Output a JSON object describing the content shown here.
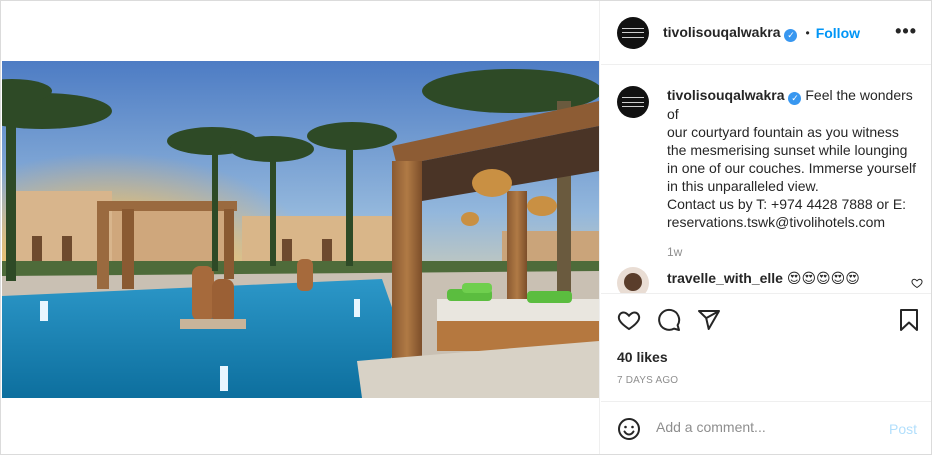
{
  "post": {
    "username": "tivolisouqalwakra",
    "follow_label": "Follow",
    "more_label": "•••",
    "separator": "•",
    "verified_glyph": "✓",
    "image_alt": "Courtyard fountain with palm trees and lounge couches at sunset"
  },
  "caption": {
    "username": "tivolisouqalwakra",
    "lines": [
      "Feel the wonders of",
      "our courtyard fountain as you witness",
      "the mesmerising sunset while lounging",
      "in one of our couches. Immerse yourself",
      "in this unparalleled view.",
      "Contact us by T: +974 4428 7888 or E:",
      "reservations.tswk@tivolihotels.com"
    ],
    "time": "1w"
  },
  "comment": {
    "username": "travelle_with_elle",
    "text": "😍😍😍😍😍"
  },
  "actions": {
    "icons": [
      "heart-icon",
      "comment-icon",
      "share-icon",
      "bookmark-icon"
    ]
  },
  "likes": "40 likes",
  "date": "7 DAYS AGO",
  "add_comment": {
    "placeholder": "Add a comment...",
    "post_label": "Post",
    "emoji_icon": "emoji-icon"
  },
  "colors": {
    "accent": "#0095f6",
    "verified": "#3897f0",
    "muted": "#8e8e8e",
    "post_disabled": "#b2dffc"
  }
}
